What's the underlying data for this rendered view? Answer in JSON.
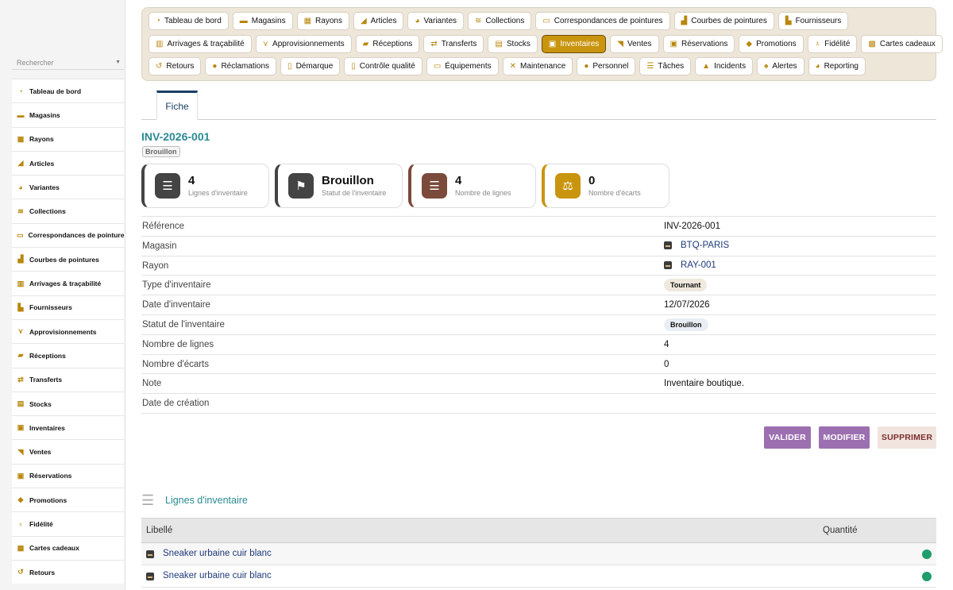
{
  "sidebar": {
    "search_placeholder": "Rechercher",
    "items": [
      {
        "label": "Tableau de bord",
        "icon": "gauge-icon"
      },
      {
        "label": "Magasins",
        "icon": "store-icon"
      },
      {
        "label": "Rayons",
        "icon": "grid-icon"
      },
      {
        "label": "Articles",
        "icon": "shoe-icon"
      },
      {
        "label": "Variantes",
        "icon": "palette-icon"
      },
      {
        "label": "Collections",
        "icon": "layers-icon"
      },
      {
        "label": "Correspondances de pointures",
        "icon": "ruler-icon"
      },
      {
        "label": "Courbes de pointures",
        "icon": "chart-icon"
      },
      {
        "label": "Arrivages & traçabilité",
        "icon": "barcode-icon"
      },
      {
        "label": "Fournisseurs",
        "icon": "factory-icon"
      },
      {
        "label": "Approvisionnements",
        "icon": "dolly-icon"
      },
      {
        "label": "Réceptions",
        "icon": "truck-icon"
      },
      {
        "label": "Transferts",
        "icon": "arrows-icon"
      },
      {
        "label": "Stocks",
        "icon": "warehouse-icon"
      },
      {
        "label": "Inventaires",
        "icon": "clipboard-check-icon"
      },
      {
        "label": "Ventes",
        "icon": "cart-icon"
      },
      {
        "label": "Réservations",
        "icon": "calendar-check-icon"
      },
      {
        "label": "Promotions",
        "icon": "tags-icon"
      },
      {
        "label": "Fidélité",
        "icon": "award-icon"
      },
      {
        "label": "Cartes cadeaux",
        "icon": "gift-icon"
      },
      {
        "label": "Retours",
        "icon": "undo-icon"
      }
    ]
  },
  "topnav": {
    "rows": [
      [
        {
          "label": "Tableau de bord",
          "icon": "gauge-icon"
        },
        {
          "label": "Magasins",
          "icon": "store-icon"
        },
        {
          "label": "Rayons",
          "icon": "grid-icon"
        },
        {
          "label": "Articles",
          "icon": "shoe-icon"
        },
        {
          "label": "Variantes",
          "icon": "palette-icon"
        },
        {
          "label": "Collections",
          "icon": "layers-icon"
        },
        {
          "label": "Correspondances de pointures",
          "icon": "ruler-icon"
        },
        {
          "label": "Courbes de pointures",
          "icon": "chart-icon"
        },
        {
          "label": "Fournisseurs",
          "icon": "factory-icon"
        }
      ],
      [
        {
          "label": "Arrivages & traçabilité",
          "icon": "barcode-icon"
        },
        {
          "label": "Approvisionnements",
          "icon": "dolly-icon"
        },
        {
          "label": "Réceptions",
          "icon": "truck-icon"
        },
        {
          "label": "Transferts",
          "icon": "arrows-icon"
        },
        {
          "label": "Stocks",
          "icon": "warehouse-icon"
        },
        {
          "label": "Inventaires",
          "icon": "clipboard-check-icon",
          "active": true
        },
        {
          "label": "Ventes",
          "icon": "cart-icon"
        },
        {
          "label": "Réservations",
          "icon": "calendar-check-icon"
        },
        {
          "label": "Promotions",
          "icon": "tags-icon"
        },
        {
          "label": "Fidélité",
          "icon": "award-icon"
        },
        {
          "label": "Cartes cadeaux",
          "icon": "gift-icon"
        }
      ],
      [
        {
          "label": "Retours",
          "icon": "undo-icon"
        },
        {
          "label": "Réclamations",
          "icon": "comment-icon"
        },
        {
          "label": "Démarque",
          "icon": "doc-icon"
        },
        {
          "label": "Contrôle qualité",
          "icon": "clipboard-icon"
        },
        {
          "label": "Équipements",
          "icon": "monitor-icon"
        },
        {
          "label": "Maintenance",
          "icon": "tools-icon"
        },
        {
          "label": "Personnel",
          "icon": "users-icon"
        },
        {
          "label": "Tâches",
          "icon": "list-icon"
        },
        {
          "label": "Incidents",
          "icon": "warning-icon"
        },
        {
          "label": "Alertes",
          "icon": "bell-icon"
        },
        {
          "label": "Reporting",
          "icon": "pie-icon"
        }
      ]
    ]
  },
  "tabs": {
    "fiche": "Fiche"
  },
  "record": {
    "title": "INV-2026-001",
    "status_badge": "Brouillon"
  },
  "cards": [
    {
      "value": "4",
      "label": "Lignes d'inventaire",
      "icon": "list-icon",
      "color": "#444444"
    },
    {
      "value": "Brouillon",
      "label": "Statut de l'inventaire",
      "icon": "flag-icon",
      "color": "#444444"
    },
    {
      "value": "4",
      "label": "Nombre de lignes",
      "icon": "list-icon",
      "color": "#7a4a3a"
    },
    {
      "value": "0",
      "label": "Nombre d'écarts",
      "icon": "balance-icon",
      "color": "#c9950f"
    }
  ],
  "fields": [
    {
      "key": "Référence",
      "value": "INV-2026-001",
      "kind": "text"
    },
    {
      "key": "Magasin",
      "value": "BTQ-PARIS",
      "kind": "link"
    },
    {
      "key": "Rayon",
      "value": "RAY-001",
      "kind": "link"
    },
    {
      "key": "Type d'inventaire",
      "value": "Tournant",
      "kind": "pill",
      "bg": "#efe9dd"
    },
    {
      "key": "Date d'inventaire",
      "value": "12/07/2026",
      "kind": "text"
    },
    {
      "key": "Statut de l'inventaire",
      "value": "Brouillon",
      "kind": "pill",
      "bg": "#e9eef5"
    },
    {
      "key": "Nombre de lignes",
      "value": "4",
      "kind": "text"
    },
    {
      "key": "Nombre d'écarts",
      "value": "0",
      "kind": "text"
    },
    {
      "key": "Note",
      "value": "Inventaire boutique.",
      "kind": "text"
    },
    {
      "key": "Date de création",
      "value": "",
      "kind": "text"
    }
  ],
  "actions": {
    "valider": {
      "label": "VALIDER",
      "bg": "#9c6fb0"
    },
    "modifier": {
      "label": "MODIFIER",
      "bg": "#9c6fb0"
    },
    "supprimer": {
      "label": "SUPPRIMER",
      "bg": "#f1e4de",
      "color": "#7a2e2e"
    }
  },
  "lines_section": {
    "title": "Lignes d'inventaire",
    "columns": [
      "Libellé",
      "Quantité"
    ],
    "rows": [
      {
        "label": "Sneaker urbaine cuir blanc"
      },
      {
        "label": "Sneaker urbaine cuir blanc"
      }
    ]
  }
}
